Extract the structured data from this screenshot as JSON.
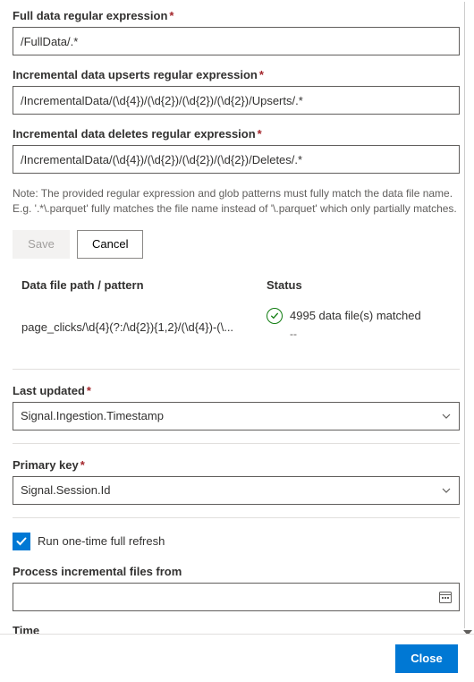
{
  "fields": {
    "fullData": {
      "label": "Full data regular expression",
      "value": "/FullData/.*"
    },
    "upserts": {
      "label": "Incremental data upserts regular expression",
      "value": "/IncrementalData/(\\d{4})/(\\d{2})/(\\d{2})/(\\d{2})/Upserts/.*"
    },
    "deletes": {
      "label": "Incremental data deletes regular expression",
      "value": "/IncrementalData/(\\d{4})/(\\d{2})/(\\d{2})/(\\d{2})/Deletes/.*"
    },
    "lastUpdated": {
      "label": "Last updated",
      "value": "Signal.Ingestion.Timestamp"
    },
    "primaryKey": {
      "label": "Primary key",
      "value": "Signal.Session.Id"
    },
    "processFrom": {
      "label": "Process incremental files from",
      "value": ""
    },
    "time": {
      "label": "Time",
      "value": ""
    }
  },
  "note": "Note: The provided regular expression and glob patterns must fully match the data file name. E.g. '.*\\.parquet' fully matches the file name instead of '\\.parquet' which only partially matches.",
  "buttons": {
    "save": "Save",
    "cancel": "Cancel",
    "close": "Close"
  },
  "table": {
    "header": {
      "path": "Data file path / pattern",
      "status": "Status"
    },
    "row": {
      "path": "page_clicks/\\d{4}(?:/\\d{2}){1,2}/(\\d{4})-(\\...",
      "status": "4995 data file(s) matched",
      "sub": "--"
    }
  },
  "checkbox": {
    "label": "Run one-time full refresh",
    "checked": true
  }
}
